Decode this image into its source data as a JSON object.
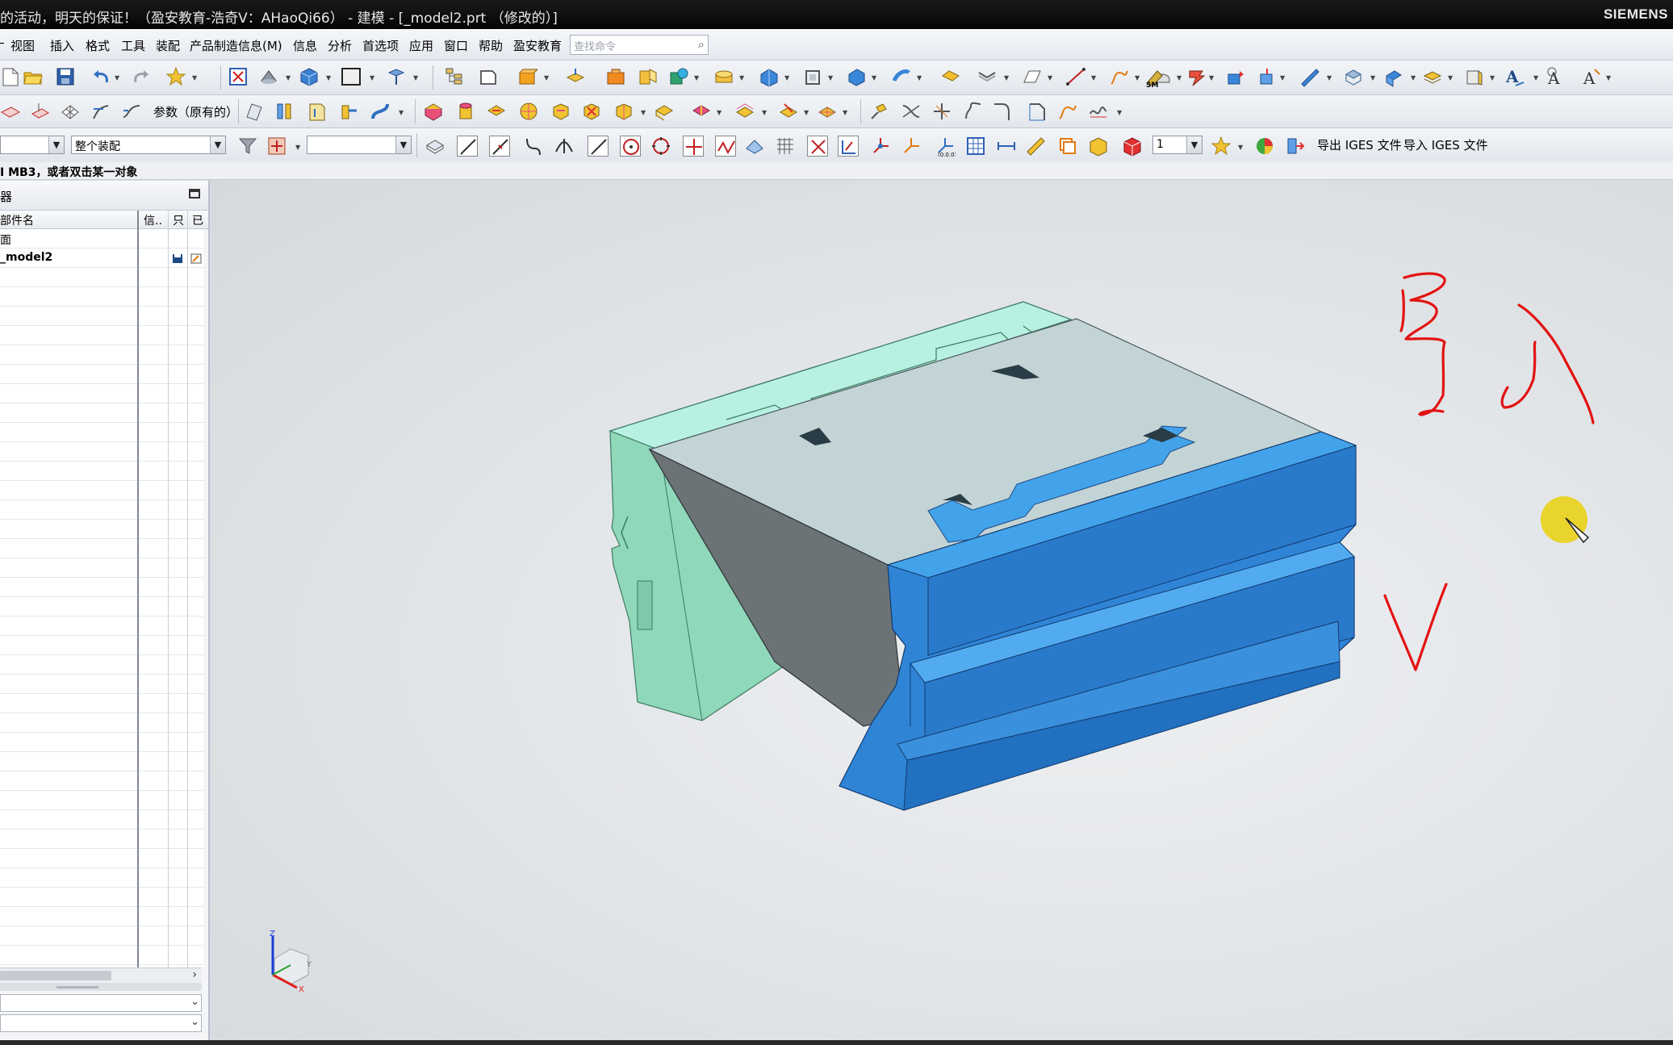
{
  "window": {
    "title": "的活动，明天的保证！（盈安教育-浩奇V：AHaoQi66） - 建模 - [_model2.prt （修改的）]",
    "brand": "SIEMENS"
  },
  "menu": {
    "items": [
      "视图",
      "插入",
      "格式",
      "工具",
      "装配",
      "产品制造信息(M)",
      "信息",
      "分析",
      "首选项",
      "应用",
      "窗口",
      "帮助",
      "盈安教育"
    ],
    "search_placeholder": "查找命令"
  },
  "toolbar2": {
    "param_label": "参数（原有的）"
  },
  "toolbar3": {
    "filter_value": "",
    "scope_value": "整个装配",
    "snap_combo_value": "",
    "count_value": "1",
    "export_iges": "导出 IGES 文件",
    "import_iges": "导入 IGES 文件"
  },
  "cue_line": "MB3，或者双击某一对象",
  "navigator": {
    "title": "器",
    "columns": [
      "部件名",
      "信..",
      "只",
      "已"
    ],
    "rows": [
      {
        "name": "面"
      },
      {
        "name": "_model2"
      }
    ]
  },
  "annotations": {
    "color": "#e31212"
  },
  "model_colors": {
    "blue": "#2f84d6",
    "blue_top": "#43a3ea",
    "mint": "#8fd8ba",
    "mint_top": "#b8f1e2",
    "gray_face": "#6c7376",
    "top_face": "#c3d4d6"
  },
  "triad": {
    "z_label": "Z",
    "x_label": "X",
    "y_label": "Y"
  }
}
